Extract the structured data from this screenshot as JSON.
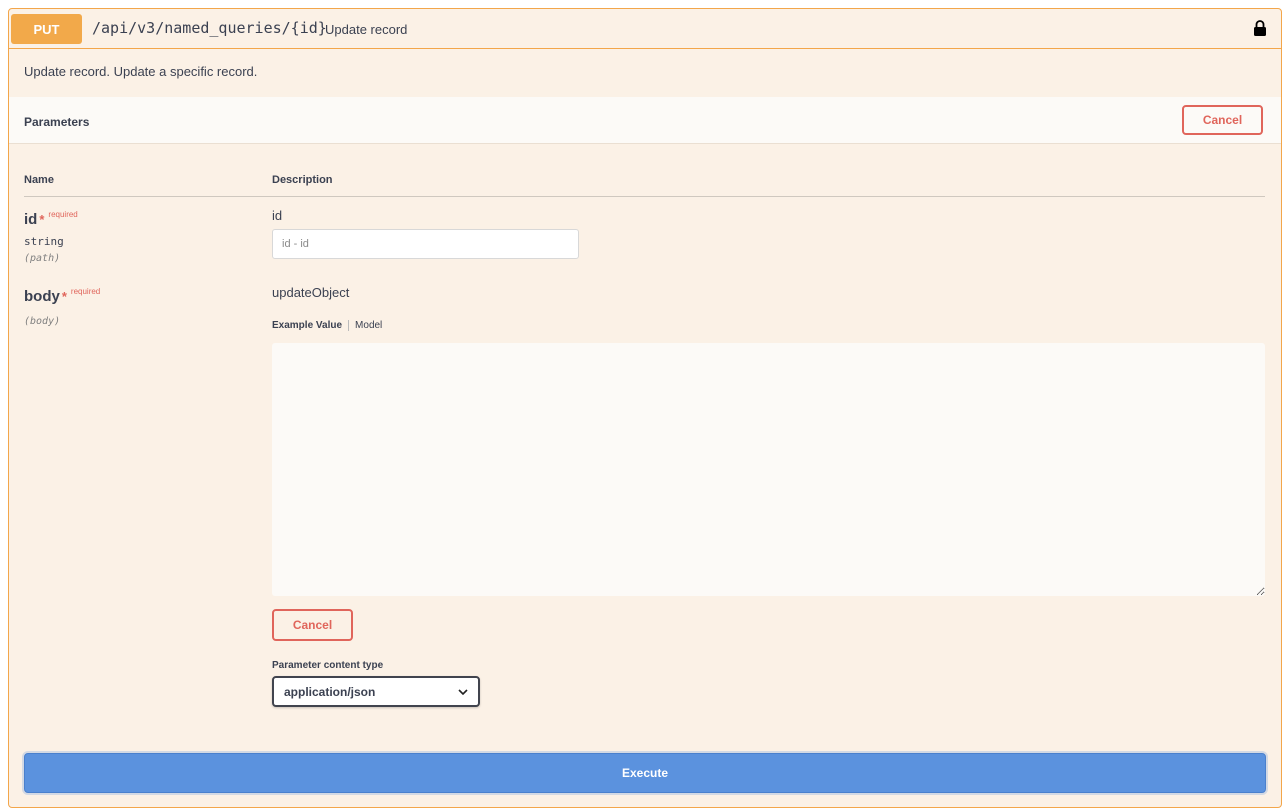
{
  "summary": {
    "method": "PUT",
    "path": "/api/v3/named_queries/{id}",
    "description": "Update record"
  },
  "description": "Update record. Update a specific record.",
  "parameters": {
    "title": "Parameters",
    "cancel_label": "Cancel",
    "columns": {
      "name": "Name",
      "description": "Description"
    },
    "items": [
      {
        "name": "id",
        "required_star": "*",
        "required_label": "required",
        "type": "string",
        "in": "(path)",
        "description": "id",
        "placeholder": "id - id"
      },
      {
        "name": "body",
        "required_star": "*",
        "required_label": "required",
        "in": "(body)",
        "description": "updateObject",
        "tabs": {
          "example": "Example Value",
          "model": "Model"
        },
        "cancel_label": "Cancel"
      }
    ]
  },
  "content_type": {
    "label": "Parameter content type",
    "selected": "application/json"
  },
  "execute_label": "Execute",
  "colors": {
    "put": "#f2a94a",
    "cancel": "#e0655b",
    "execute": "#5b92de",
    "block_bg": "#fbf1e6"
  },
  "icons": {
    "lock": "lock-icon",
    "chevron": "chevron-down-icon"
  }
}
